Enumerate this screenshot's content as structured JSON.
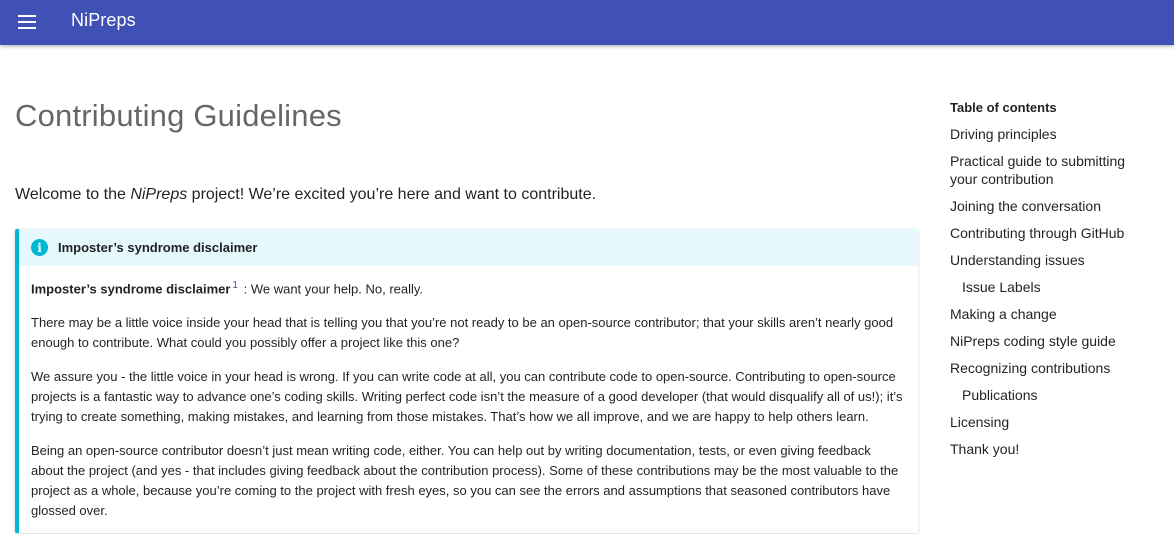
{
  "header": {
    "site_title": "NiPreps",
    "menu_icon": "hamburger-menu-icon",
    "bar_color": "#3f51b5"
  },
  "main": {
    "page_title": "Contributing Guidelines",
    "intro": {
      "before": "Welcome to the ",
      "emphasis": "NiPreps",
      "after": " project! We’re excited you’re here and want to contribute."
    },
    "admonition": {
      "icon": "info-icon",
      "icon_glyph": "i",
      "accent_color": "#00b8d4",
      "title": "Imposter’s syndrome disclaimer",
      "lead_bold": "Imposter’s syndrome disclaimer",
      "footnote_ref": "1",
      "lead_rest": " : We want your help. No, really.",
      "paragraphs": [
        "There may be a little voice inside your head that is telling you that you’re not ready to be an open-source contributor; that your skills aren’t nearly good enough to contribute. What could you possibly offer a project like this one?",
        "We assure you - the little voice in your head is wrong. If you can write code at all, you can contribute code to open-source. Contributing to open-source projects is a fantastic way to advance one’s coding skills. Writing perfect code isn’t the measure of a good developer (that would disqualify all of us!); it’s trying to create something, making mistakes, and learning from those mistakes. That’s how we all improve, and we are happy to help others learn.",
        "Being an open-source contributor doesn’t just mean writing code, either. You can help out by writing documentation, tests, or even giving feedback about the project (and yes - that includes giving feedback about the contribution process). Some of these contributions may be the most valuable to the project as a whole, because you’re coming to the project with fresh eyes, so you can see the errors and assumptions that seasoned contributors have glossed over."
      ]
    }
  },
  "toc": {
    "title": "Table of contents",
    "items": [
      {
        "label": "Driving principles",
        "level": 1
      },
      {
        "label": "Practical guide to submitting your contribution",
        "level": 1
      },
      {
        "label": "Joining the conversation",
        "level": 1
      },
      {
        "label": "Contributing through GitHub",
        "level": 1
      },
      {
        "label": "Understanding issues",
        "level": 1
      },
      {
        "label": "Issue Labels",
        "level": 2
      },
      {
        "label": "Making a change",
        "level": 1
      },
      {
        "label": "NiPreps coding style guide",
        "level": 1
      },
      {
        "label": "Recognizing contributions",
        "level": 1
      },
      {
        "label": "Publications",
        "level": 2
      },
      {
        "label": "Licensing",
        "level": 1
      },
      {
        "label": "Thank you!",
        "level": 1
      }
    ]
  }
}
